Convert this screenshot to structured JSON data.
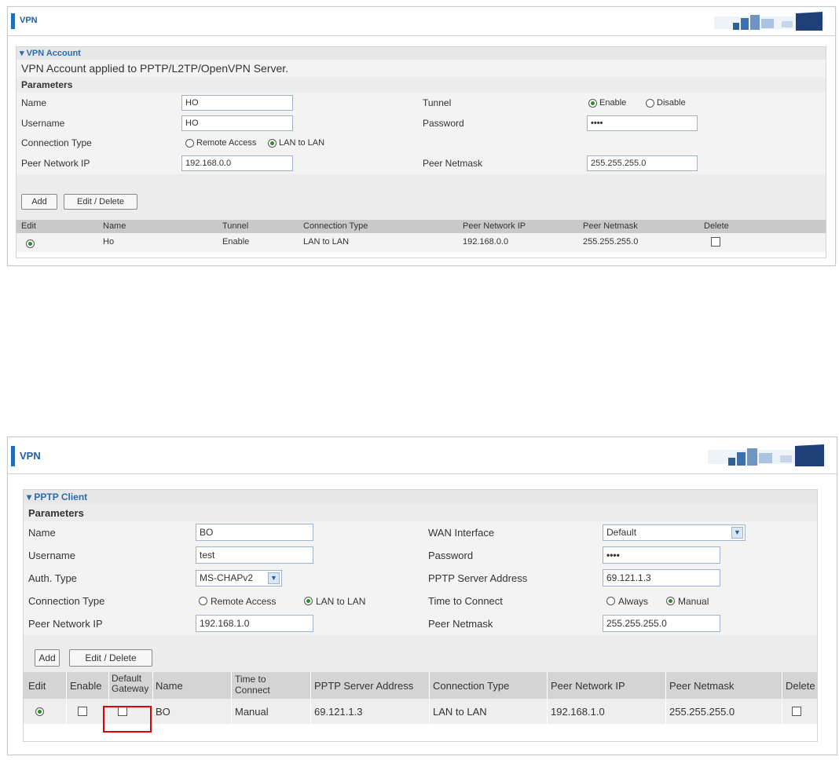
{
  "vpn_account": {
    "header_title": "VPN",
    "section_title": "▾ VPN Account",
    "description": "VPN Account applied to PPTP/L2TP/OpenVPN Server.",
    "parameters_label": "Parameters",
    "name_label": "Name",
    "name_value": "HO",
    "tunnel_label": "Tunnel",
    "tunnel_enable": "Enable",
    "tunnel_disable": "Disable",
    "username_label": "Username",
    "username_value": "HO",
    "password_label": "Password",
    "password_value": "••••",
    "conn_type_label": "Connection Type",
    "remote_access": "Remote Access",
    "lan_to_lan": "LAN to LAN",
    "peer_ip_label": "Peer Network IP",
    "peer_ip_value": "192.168.0.0",
    "peer_mask_label": "Peer Netmask",
    "peer_mask_value": "255.255.255.0",
    "add_label": "Add",
    "edit_delete_label": "Edit / Delete",
    "table_headers": [
      "Edit",
      "Name",
      "Tunnel",
      "Connection Type",
      "Peer Network IP",
      "Peer Netmask",
      "Delete"
    ],
    "rows": [
      {
        "name": "Ho",
        "tunnel": "Enable",
        "conn": "LAN to LAN",
        "peer_ip": "192.168.0.0",
        "peer_mask": "255.255.255.0"
      }
    ]
  },
  "pptp_client": {
    "header_title": "VPN",
    "section_title": "▾ PPTP Client",
    "parameters_label": "Parameters",
    "name_label": "Name",
    "name_value": "BO",
    "wan_label": "WAN Interface",
    "wan_value": "Default",
    "username_label": "Username",
    "username_value": "test",
    "password_label": "Password",
    "password_value": "••••",
    "auth_label": "Auth. Type",
    "auth_value": "MS-CHAPv2",
    "server_label": "PPTP Server Address",
    "server_value": "69.121.1.3",
    "conn_type_label": "Connection Type",
    "remote_access": "Remote Access",
    "lan_to_lan": "LAN to LAN",
    "time_label": "Time to Connect",
    "always": "Always",
    "manual": "Manual",
    "peer_ip_label": "Peer Network IP",
    "peer_ip_value": "192.168.1.0",
    "peer_mask_label": "Peer Netmask",
    "peer_mask_value": "255.255.255.0",
    "add_label": "Add",
    "edit_delete_label": "Edit / Delete",
    "th_edit": "Edit",
    "th_enable": "Enable",
    "th_default_gw_1": "Default",
    "th_default_gw_2": "Gateway",
    "th_name": "Name",
    "th_time_1": "Time to",
    "th_time_2": "Connect",
    "th_server": "PPTP Server Address",
    "th_conn": "Connection Type",
    "th_peer_ip": "Peer Network IP",
    "th_peer_mask": "Peer Netmask",
    "th_delete": "Delete",
    "rows": [
      {
        "name": "BO",
        "time": "Manual",
        "server": "69.121.1.3",
        "conn": "LAN to LAN",
        "peer_ip": "192.168.1.0",
        "peer_mask": "255.255.255.0"
      }
    ]
  },
  "colors": {
    "accent": "#1e6fb7",
    "highlight_box": "#e00000"
  }
}
